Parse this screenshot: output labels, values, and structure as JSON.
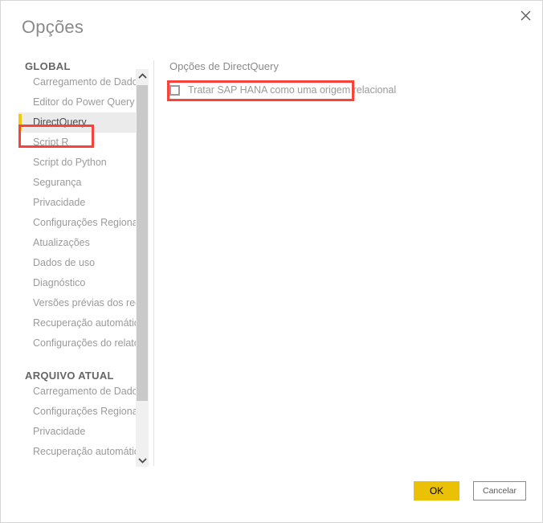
{
  "dialog": {
    "title": "Opções",
    "close_icon": "close-icon"
  },
  "sidebar": {
    "groups": [
      {
        "title": "GLOBAL",
        "items": [
          {
            "label": "Carregamento de Dados",
            "selected": false
          },
          {
            "label": "Editor do Power Query",
            "selected": false
          },
          {
            "label": "DirectQuery",
            "selected": true
          },
          {
            "label": "Script R",
            "selected": false
          },
          {
            "label": "Script do Python",
            "selected": false
          },
          {
            "label": "Segurança",
            "selected": false
          },
          {
            "label": "Privacidade",
            "selected": false
          },
          {
            "label": "Configurações Regionais",
            "selected": false
          },
          {
            "label": "Atualizações",
            "selected": false
          },
          {
            "label": "Dados de uso",
            "selected": false
          },
          {
            "label": "Diagnóstico",
            "selected": false
          },
          {
            "label": "Versões prévias dos recursos",
            "selected": false
          },
          {
            "label": "Recuperação automática",
            "selected": false
          },
          {
            "label": "Configurações do relatório",
            "selected": false
          }
        ]
      },
      {
        "title": "ARQUIVO ATUAL",
        "items": [
          {
            "label": "Carregamento de Dados",
            "selected": false
          },
          {
            "label": "Configurações Regionais",
            "selected": false
          },
          {
            "label": "Privacidade",
            "selected": false
          },
          {
            "label": "Recuperação automática",
            "selected": false
          }
        ]
      }
    ],
    "scrollbar": {
      "up_icon": "chevron-up-icon",
      "down_icon": "chevron-down-icon"
    }
  },
  "content": {
    "heading": "Opções de DirectQuery",
    "checkbox": {
      "label": "Tratar SAP HANA como uma origem relacional",
      "checked": false
    }
  },
  "footer": {
    "ok_label": "OK",
    "cancel_label": "Cancelar"
  },
  "colors": {
    "accent_yellow": "#f2c811",
    "ok_button": "#ebc106",
    "annotation_red": "#f9423a",
    "selected_bg": "#ebebeb",
    "text_gray": "#9a9a9a"
  }
}
